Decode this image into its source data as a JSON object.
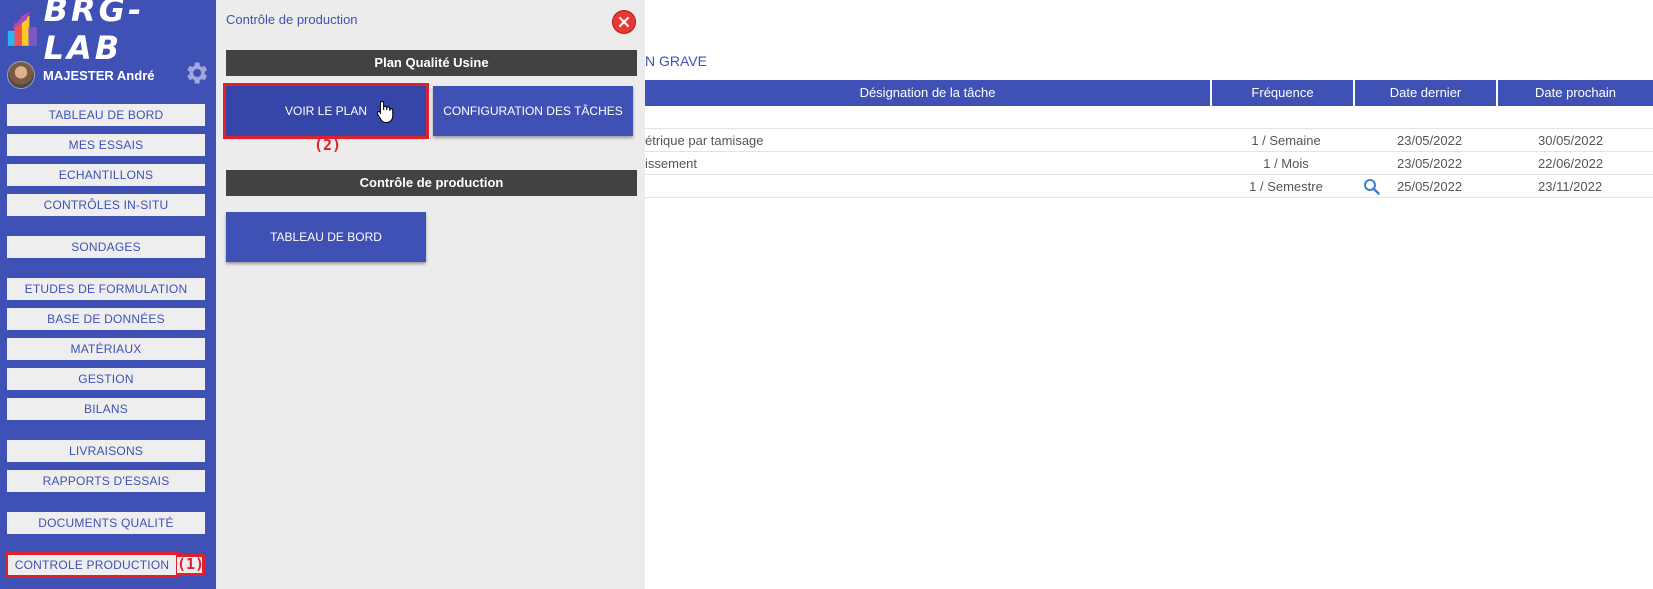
{
  "logo": {
    "text": "BRG-LAB",
    "icon": "brg-lab-logo-icon"
  },
  "user": {
    "name": "MAJESTER André",
    "settings_icon": "gear-icon"
  },
  "sidebar": {
    "items": [
      {
        "label": "TABLEAU DE BORD"
      },
      {
        "label": "MES ESSAIS"
      },
      {
        "label": "ECHANTILLONS"
      },
      {
        "label": "CONTRÔLES IN-SITU"
      },
      {
        "label": "SONDAGES"
      },
      {
        "label": "ETUDES DE FORMULATION"
      },
      {
        "label": "BASE DE DONNÉES"
      },
      {
        "label": "MATÉRIAUX"
      },
      {
        "label": "GESTION"
      },
      {
        "label": "BILANS"
      },
      {
        "label": "LIVRAISONS"
      },
      {
        "label": "RAPPORTS D'ESSAIS"
      },
      {
        "label": "DOCUMENTS QUALITÉ"
      },
      {
        "label": "CONTROLE PRODUCTION"
      }
    ],
    "annotation": "(1)"
  },
  "panel": {
    "title": "Contrôle de production",
    "section1": "Plan Qualité Usine",
    "view_plan": "VOIR LE PLAN",
    "config_tasks": "CONFIGURATION DES TÂCHES",
    "annotation": "(2)",
    "section2": "Contrôle de production",
    "dashboard": "TABLEAU DE BORD"
  },
  "main": {
    "breadcrumb": "N GRAVE",
    "columns": [
      "Désignation de la tâche",
      "Fréquence",
      "Date dernier",
      "Date prochain"
    ],
    "rows": [
      {
        "task": "étrique par tamisage",
        "freq": "1 / Semaine",
        "last": "23/05/2022",
        "next": "30/05/2022"
      },
      {
        "task": "issement",
        "freq": "1 / Mois",
        "last": "23/05/2022",
        "next": "22/06/2022"
      },
      {
        "task": "",
        "freq": "1 / Semestre",
        "last": "25/05/2022",
        "next": "23/11/2022"
      }
    ]
  },
  "colors": {
    "primary": "#3f51b5",
    "dark_bar": "#424242",
    "annotation_red": "#e0202e",
    "close_red": "#e53935"
  }
}
